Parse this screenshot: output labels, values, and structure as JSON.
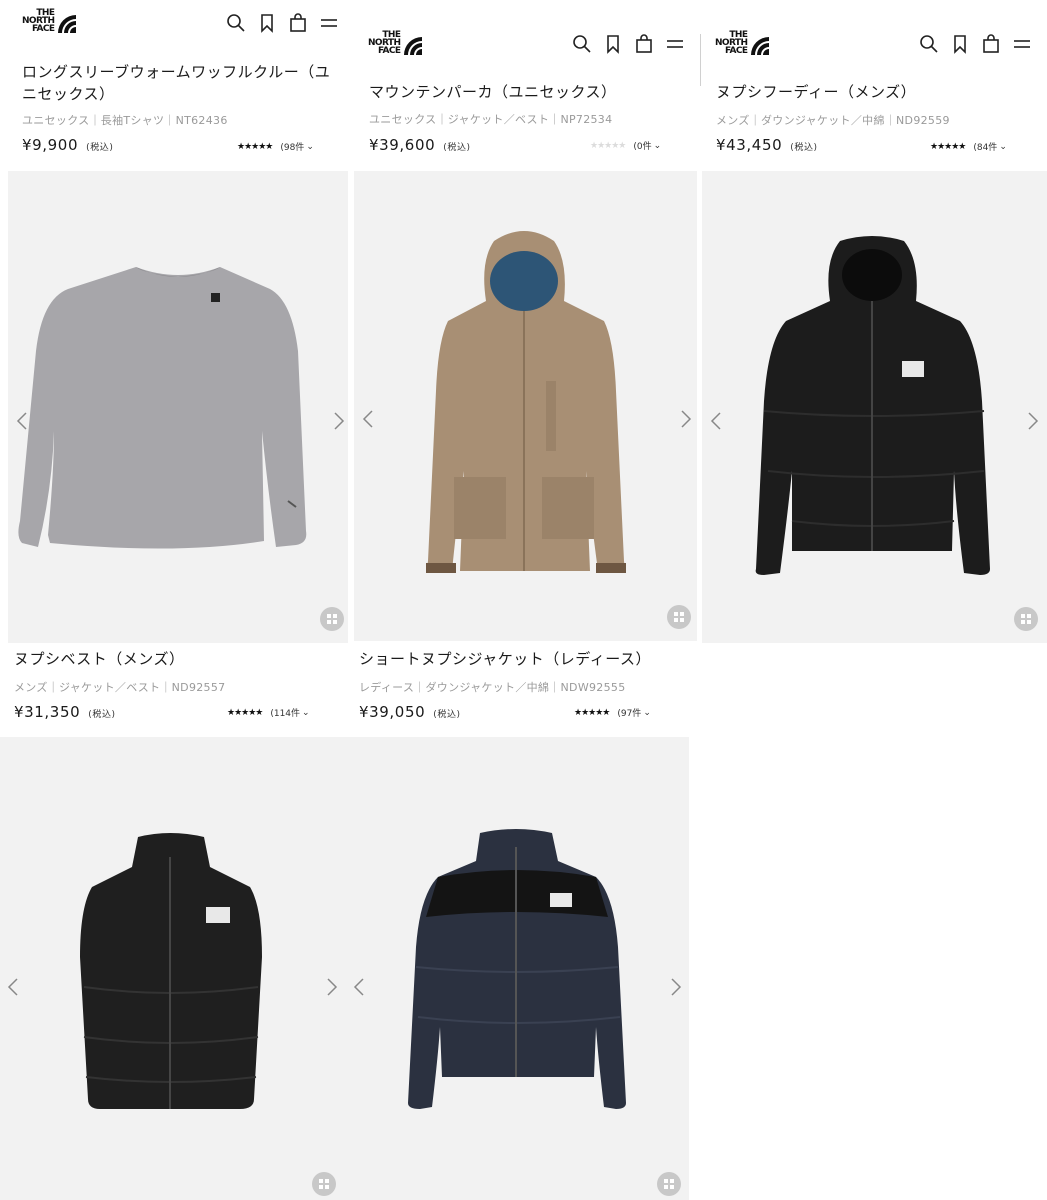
{
  "logo": {
    "text_lines": [
      "THE",
      "NORTH",
      "FACE"
    ]
  },
  "icons": {
    "search": "search-icon",
    "bookmark": "bookmark-icon",
    "cart": "cart-icon",
    "menu": "menu-icon",
    "prev": "chevron-left-icon",
    "next": "chevron-right-icon",
    "zoom": "zoom-grid-icon"
  },
  "colors": {
    "page_bg": "#ffffff",
    "image_bg": "#f2f2f2",
    "text": "#1a1a1a",
    "meta": "#9a9a9a",
    "zoom_bg": "#c8c8c8"
  },
  "products": [
    {
      "title_line1": "ロングスリーブウォームワッフルクルー（ユ",
      "title_line2": "ニセックス）",
      "meta": "ユニセックス｜長袖Tシャツ｜NT62436",
      "price": "¥9,900",
      "tax": "(税込)",
      "stars": "★★★★★",
      "review_count": "(98件",
      "image": "gray-waffle-crew-shirt"
    },
    {
      "title": "マウンテンパーカ（ユニセックス）",
      "meta": "ユニセックス｜ジャケット／ベスト｜NP72534",
      "price": "¥39,600",
      "tax": "(税込)",
      "stars": "★★★★★",
      "review_count": "(0件",
      "image": "beige-mountain-parka"
    },
    {
      "title": "ヌプシフーディー（メンズ）",
      "meta": "メンズ｜ダウンジャケット／中綿｜ND92559",
      "price": "¥43,450",
      "tax": "(税込)",
      "stars": "★★★★★",
      "review_count": "(84件",
      "image": "black-nuptse-hoodie"
    },
    {
      "title": "ヌプシベスト（メンズ）",
      "meta": "メンズ｜ジャケット／ベスト｜ND92557",
      "price": "¥31,350",
      "tax": "(税込)",
      "stars": "★★★★★",
      "review_count": "(114件",
      "image": "black-nuptse-vest"
    },
    {
      "title": "ショートヌプシジャケット（レディース）",
      "meta": "レディース｜ダウンジャケット／中綿｜NDW92555",
      "price": "¥39,050",
      "tax": "(税込)",
      "stars": "★★★★★",
      "review_count": "(97件",
      "image": "navy-short-nuptse-jacket"
    }
  ]
}
